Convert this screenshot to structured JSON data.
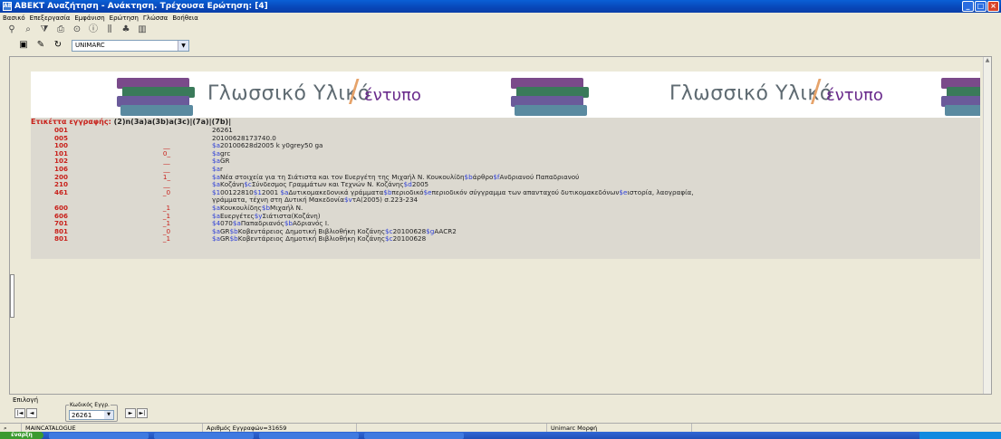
{
  "window": {
    "title": "ΑΒΕΚΤ Αναζήτηση - Ανάκτηση. Τρέχουσα Ερώτηση: [4]",
    "app_icon": "AB"
  },
  "menu": [
    "Βασικό",
    "Επεξεργασία",
    "Εμφάνιση",
    "Ερώτηση",
    "Γλώσσα",
    "Βοήθεια"
  ],
  "toolbar_icons": [
    "binoculars-icon",
    "search-icon",
    "filter-icon",
    "print-icon",
    "print-preview-icon",
    "info-icon",
    "barcode-icon",
    "tree-icon",
    "chart-icon"
  ],
  "format_select": {
    "value": "UNIMARC"
  },
  "banner": {
    "text1": "Γλωσσικό Υλικό",
    "text2": "έντυπο",
    "slash": "/"
  },
  "record": {
    "label_prefix": "Ετικέττα εγγραφής:",
    "label_value": "(2)n(3a)a(3b)a(3c)|(7a)|(7b)|",
    "rows": [
      {
        "tag": "001",
        "ind": "",
        "data": [
          [
            "t",
            "26261"
          ]
        ]
      },
      {
        "tag": "005",
        "ind": "",
        "data": [
          [
            "t",
            "20100628173740.0"
          ]
        ]
      },
      {
        "tag": "100",
        "ind": "__",
        "data": [
          [
            "s",
            "$a"
          ],
          [
            "t",
            "20100628d2005 k y0grey50 ga"
          ]
        ]
      },
      {
        "tag": "101",
        "ind": "0_",
        "data": [
          [
            "s",
            "$a"
          ],
          [
            "t",
            "grc"
          ]
        ]
      },
      {
        "tag": "102",
        "ind": "__",
        "data": [
          [
            "s",
            "$a"
          ],
          [
            "t",
            "GR"
          ]
        ]
      },
      {
        "tag": "106",
        "ind": "__",
        "data": [
          [
            "s",
            "$a"
          ],
          [
            "t",
            "r"
          ]
        ]
      },
      {
        "tag": "200",
        "ind": "1_",
        "data": [
          [
            "s",
            "$a"
          ],
          [
            "t",
            "Νέα στοιχεία για τη Σιάτιστα και τον Ευεργέτη της Μιχαήλ Ν. Κουκουλίδη"
          ],
          [
            "s",
            "$b"
          ],
          [
            "t",
            "άρθρο"
          ],
          [
            "s",
            "$f"
          ],
          [
            "t",
            "Ανδριανού Παπαδριανού"
          ]
        ]
      },
      {
        "tag": "210",
        "ind": "__",
        "data": [
          [
            "s",
            "$a"
          ],
          [
            "t",
            "Κοζάνη"
          ],
          [
            "s",
            "$c"
          ],
          [
            "t",
            "Σύνδεσμος Γραμμάτων και Τεχνών Ν. Κοζάνης"
          ],
          [
            "s",
            "$d"
          ],
          [
            "t",
            "2005"
          ]
        ]
      },
      {
        "tag": "461",
        "ind": "_0",
        "data": [
          [
            "s",
            "$1"
          ],
          [
            "t",
            "00122810"
          ],
          [
            "s",
            "$1"
          ],
          [
            "t",
            "2001 "
          ],
          [
            "s",
            "$a"
          ],
          [
            "t",
            "Δυτικομακεδονικά γράμματα"
          ],
          [
            "s",
            "$b"
          ],
          [
            "t",
            "περιοδικό"
          ],
          [
            "s",
            "$e"
          ],
          [
            "t",
            "περιοδικόν σύγγραμμα των απανταχού δυτικομακεδόνων"
          ],
          [
            "s",
            "$e"
          ],
          [
            "t",
            "ιστορία, λαογραφία,"
          ]
        ]
      },
      {
        "tag": "",
        "ind": "",
        "data": [
          [
            "t",
            "γράμματα, τέχνη στη Δυτική Μακεδονία"
          ],
          [
            "s",
            "$v"
          ],
          [
            "t",
            "τΑ(2005) σ.223-234"
          ]
        ]
      },
      {
        "tag": "600",
        "ind": "_1",
        "data": [
          [
            "s",
            "$a"
          ],
          [
            "t",
            "Κουκουλίδης"
          ],
          [
            "s",
            "$b"
          ],
          [
            "t",
            "Μιχαήλ Ν."
          ]
        ]
      },
      {
        "tag": "606",
        "ind": "_1",
        "data": [
          [
            "s",
            "$a"
          ],
          [
            "t",
            "Ευεργέτες"
          ],
          [
            "s",
            "$y"
          ],
          [
            "t",
            "Σιάτιστα(Κοζάνη)"
          ]
        ]
      },
      {
        "tag": "701",
        "ind": "_1",
        "data": [
          [
            "s",
            "$4"
          ],
          [
            "t",
            "070"
          ],
          [
            "s",
            "$a"
          ],
          [
            "t",
            "Παπαδριανός"
          ],
          [
            "s",
            "$b"
          ],
          [
            "t",
            "Αδριανός Ι."
          ]
        ]
      },
      {
        "tag": "801",
        "ind": "_0",
        "data": [
          [
            "s",
            "$a"
          ],
          [
            "t",
            "GR"
          ],
          [
            "s",
            "$b"
          ],
          [
            "t",
            "Κοβεντάρειος Δημοτική Βιβλιοθήκη Κοζάνης"
          ],
          [
            "s",
            "$c"
          ],
          [
            "t",
            "20100628"
          ],
          [
            "s",
            "$g"
          ],
          [
            "t",
            "AACR2"
          ]
        ]
      },
      {
        "tag": "801",
        "ind": "_1",
        "data": [
          [
            "s",
            "$a"
          ],
          [
            "t",
            "GR"
          ],
          [
            "s",
            "$b"
          ],
          [
            "t",
            "Κοβεντάρειος Δημοτική Βιβλιοθήκη Κοζάνης"
          ],
          [
            "s",
            "$c"
          ],
          [
            "t",
            "20100628"
          ]
        ]
      }
    ]
  },
  "selection": {
    "group_label": "Επιλογή",
    "code_label": "Κωδικός Εγγρ.",
    "code_value": "26261"
  },
  "status": {
    "catalog": "MAINCATALOGUE",
    "count": "Αριθμός Εγγραφών=31659",
    "form": "Unimarc Μορφή"
  },
  "taskbar": {
    "start": "έναρξη"
  },
  "colors": {
    "tag_red": "#c8201a",
    "subfield_blue": "#2c3ed6",
    "banner_purple": "#6a2b8c",
    "banner_slash": "#e6a36a"
  }
}
